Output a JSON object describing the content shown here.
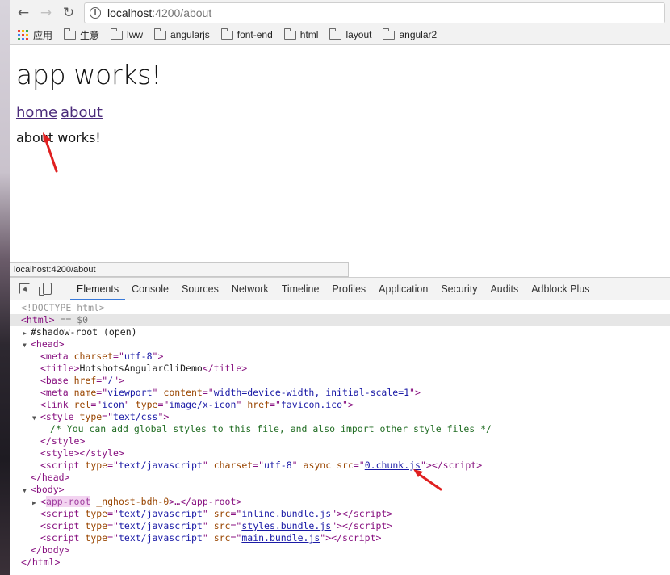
{
  "browser": {
    "url_host": "localhost",
    "url_rest": ":4200/about",
    "status_url": "localhost:4200/about"
  },
  "bookmarks": [
    {
      "label": "应用",
      "icon": "apps-grid-icon"
    },
    {
      "label": "生意",
      "icon": "folder-icon"
    },
    {
      "label": "lww",
      "icon": "folder-icon"
    },
    {
      "label": "angularjs",
      "icon": "folder-icon"
    },
    {
      "label": "font-end",
      "icon": "folder-icon"
    },
    {
      "label": "html",
      "icon": "folder-icon"
    },
    {
      "label": "layout",
      "icon": "folder-icon"
    },
    {
      "label": "angular2",
      "icon": "folder-icon"
    }
  ],
  "page": {
    "title": "app works!",
    "nav_home": "home",
    "nav_about": "about",
    "content": "about works!"
  },
  "devtools": {
    "tabs": [
      "Elements",
      "Console",
      "Sources",
      "Network",
      "Timeline",
      "Profiles",
      "Application",
      "Security",
      "Audits",
      "Adblock Plus"
    ],
    "active_tab": "Elements",
    "dom": {
      "doctype": "<!DOCTYPE html>",
      "html_open": "<html>",
      "selected_marker": "== $0",
      "shadow_root": "#shadow-root (open)",
      "head_open": "<head>",
      "meta_charset": "utf-8",
      "title_text": "HotshotsAngularCliDemo",
      "base_href": "/",
      "meta_name": "viewport",
      "meta_content": "width=device-width, initial-scale=1",
      "link_rel": "icon",
      "link_type": "image/x-icon",
      "link_href": "favicon.ico",
      "style_type": "text/css",
      "style_comment": "/* You can add global styles to this file, and also import other style files */",
      "script_type": "text/javascript",
      "script_charset": "utf-8",
      "script_src": "0.chunk.js",
      "app_root": "app-root",
      "app_root_attr": "_nghost-bdh-0",
      "inline_src": "inline.bundle.js",
      "styles_src": "styles.bundle.js",
      "main_src": "main.bundle.js"
    }
  },
  "colors": {
    "annotation_arrow": "#e02020",
    "devtools_tab_active": "#3879d9"
  }
}
